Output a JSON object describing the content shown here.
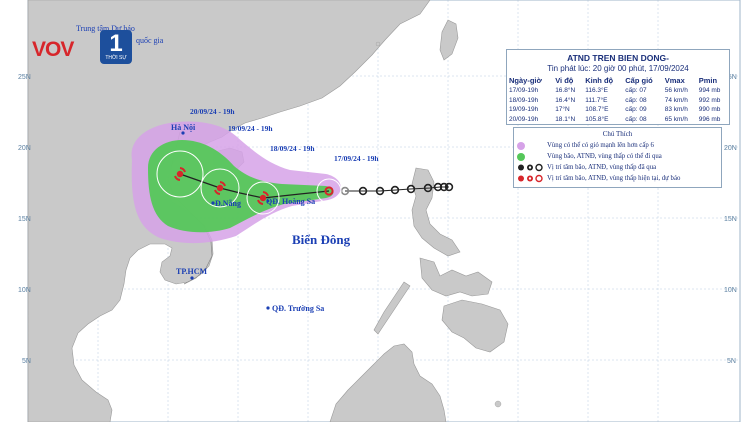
{
  "bulletin": {
    "title": "ATND TREN BIEN DONG-",
    "issued": "Tin phát lúc: 20 giờ 00 phút, 17/09/2024",
    "columns": [
      "Ngày-giờ",
      "Vi độ",
      "Kinh độ",
      "Cấp gió",
      "Vmax",
      "Pmin"
    ],
    "rows": [
      {
        "time": "17/09-19h",
        "lat": "16.8°N",
        "lon": "116.3°E",
        "level": "cấp: 07",
        "vmax": "56 km/h",
        "pmin": "994 mb"
      },
      {
        "time": "18/09-19h",
        "lat": "16.4°N",
        "lon": "111.7°E",
        "level": "cấp: 08",
        "vmax": "74 km/h",
        "pmin": "992 mb"
      },
      {
        "time": "19/09-19h",
        "lat": "17°N",
        "lon": "108.7°E",
        "level": "cấp: 09",
        "vmax": "83 km/h",
        "pmin": "990 mb"
      },
      {
        "time": "20/09-19h",
        "lat": "18.1°N",
        "lon": "105.8°E",
        "level": "cấp: 08",
        "vmax": "65 km/h",
        "pmin": "996 mb"
      }
    ]
  },
  "legend": {
    "title": "Chú Thích",
    "items": [
      {
        "text": "Vùng có thể có gió mạnh lên hơn cấp 6",
        "color": "#d6a2e8"
      },
      {
        "text": "Vùng bão, ATNĐ, vùng thấp có thể đi qua",
        "color": "#55c75a"
      },
      {
        "text": "Vị trí tâm bão, ATNĐ, vùng thấp đã qua",
        "color": "#222222"
      },
      {
        "text": "Vị trí tâm bão, ATNĐ, vùng thấp hiện tại, dự báo",
        "color": "#d7262b"
      }
    ]
  },
  "map": {
    "sea_label": "Biển Đông",
    "places": {
      "hanoi": "Hà Nội",
      "danang": "Đ.Nẵng",
      "hoangsa": "QĐ. Hoàng Sa",
      "hcm": "TP.HCM",
      "truongsa": "QĐ. Trường Sa"
    },
    "forecast_labels": [
      "20/09/24 - 19h",
      "19/09/24 - 19h",
      "18/09/24 - 19h",
      "17/09/24 - 19h"
    ],
    "lat_ticks": [
      "25N",
      "20N",
      "15N",
      "10N",
      "5N"
    ]
  },
  "brand": {
    "vov": "VOV",
    "channel": "1",
    "caption": "THỜI SỰ",
    "center": "Trung tâm Dự báo",
    "national": "quốc gia"
  },
  "colors": {
    "sea": "#ffffff",
    "land": "#c9c9c9",
    "track": "#222222",
    "storm_red": "#d7262b",
    "wind_zone": "#d6a2e8",
    "storm_zone": "#55c75a"
  }
}
